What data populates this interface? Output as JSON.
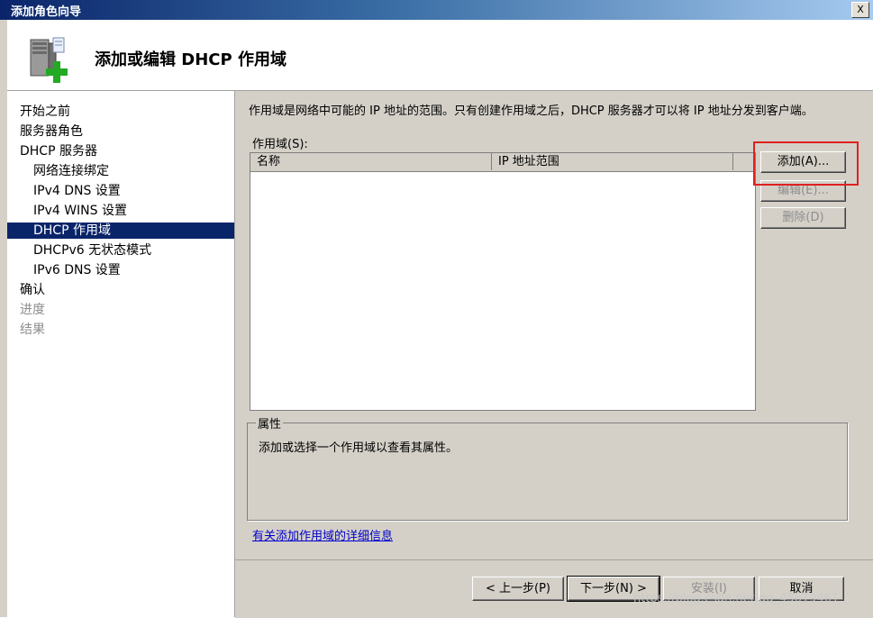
{
  "window": {
    "title": "添加角色向导",
    "close_label": "X"
  },
  "header": {
    "title": "添加或编辑 DHCP 作用域",
    "icon": "server-add-icon"
  },
  "nav": {
    "items": [
      {
        "label": "开始之前"
      },
      {
        "label": "服务器角色"
      },
      {
        "label": "DHCP 服务器"
      },
      {
        "label": "网络连接绑定"
      },
      {
        "label": "IPv4 DNS 设置"
      },
      {
        "label": "IPv4 WINS 设置"
      },
      {
        "label": "DHCP 作用域"
      },
      {
        "label": "DHCPv6 无状态模式"
      },
      {
        "label": "IPv6 DNS 设置"
      },
      {
        "label": "确认"
      },
      {
        "label": "进度"
      },
      {
        "label": "结果"
      }
    ]
  },
  "main": {
    "description": "作用域是网络中可能的 IP 地址的范围。只有创建作用域之后，DHCP 服务器才可以将 IP 地址分发到客户端。",
    "scopes_label": "作用域(S):",
    "columns": [
      "名称",
      "IP 地址范围"
    ],
    "buttons": {
      "add": "添加(A)...",
      "edit": "编辑(E)...",
      "delete": "删除(D)"
    },
    "properties_label": "属性",
    "properties_text": "添加或选择一个作用域以查看其属性。",
    "more_info_link": "有关添加作用域的详细信息"
  },
  "footer": {
    "back": "< 上一步(P)",
    "next": "下一步(N) >",
    "install": "安装(I)",
    "cancel": "取消"
  },
  "watermark": "https://blog.csdn.net/qq_43619461",
  "colors": {
    "selection": "#0a246a",
    "link": "#0000cc",
    "highlight": "#e02020",
    "panel": "#d4d0c8"
  }
}
